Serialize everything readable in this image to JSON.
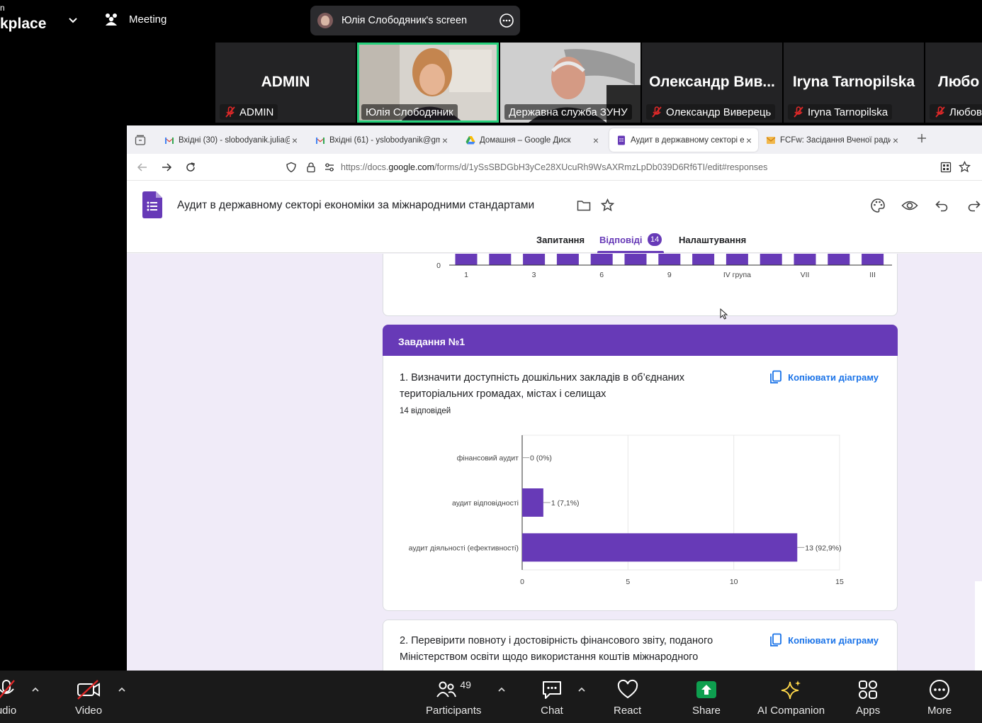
{
  "zoom": {
    "brand_top": "n",
    "brand": "kplace",
    "meeting_label": "Meeting",
    "share_pill_text": "Юлія Слободяник's screen",
    "participants": [
      {
        "big": "ADMIN",
        "name": "ADMIN",
        "muted": true
      },
      {
        "big": "",
        "name": "Юлія Слободяник",
        "muted": false,
        "video": true,
        "active": true
      },
      {
        "big": "",
        "name": "Державна служба ЗУНУ",
        "muted": false,
        "video": true
      },
      {
        "big": "Олександр Вив...",
        "name": "Олександр Виверець",
        "muted": true
      },
      {
        "big": "Iryna Tarnopilska",
        "name": "Iryna Tarnopilska",
        "muted": true
      },
      {
        "big": "Любо",
        "name": "Любов",
        "muted": true
      }
    ],
    "toolbar": {
      "audio": "udio",
      "video": "Video",
      "participants": "Participants",
      "participants_count": "49",
      "chat": "Chat",
      "react": "React",
      "share": "Share",
      "ai": "AI Companion",
      "apps": "Apps",
      "more": "More"
    }
  },
  "browser": {
    "tabs": [
      {
        "title": "Вхідні (30) - slobodyanik.julia@",
        "icon": "gmail-icon"
      },
      {
        "title": "Вхідні (61) - yslobodyanik@gm",
        "icon": "gmail-icon"
      },
      {
        "title": "Домашня – Google Диск",
        "icon": "drive-icon"
      },
      {
        "title": "Аудит в державному секторі е",
        "icon": "forms-icon",
        "active": true
      },
      {
        "title": "FCFw: Засідання Вченої ради е",
        "icon": "mail-icon"
      }
    ],
    "url_prefix": "https://docs.",
    "url_domain": "google.com",
    "url_suffix": "/forms/d/1ySsSBDGbH3yCe28XUcuRh9WsAXRmzLpDb039D6Rf6TI/edit#responses"
  },
  "form": {
    "title": "Аудит в державному секторі економіки за міжнародними стандартами",
    "tabs": {
      "questions": "Запитання",
      "responses": "Відповіді",
      "settings": "Налаштування"
    },
    "responses_count": "14",
    "section_title": "Завдання №1",
    "copy_label": "Копіювати діаграму",
    "q1_title": "1. Визначити доступність дошкільних закладів в об’єднаних територіальних громадах, містах і селищах",
    "q1_count": "14 відповідей",
    "q2_title": "2. Перевірити повноту і достовірність фінансового звіту, поданого Міністерством освіти щодо використання коштів міжнародного"
  },
  "chart_data": [
    {
      "type": "bar",
      "note_visible": "partially scrolled",
      "categories": [
        "1",
        "",
        "3",
        "",
        "6",
        "",
        "9",
        "",
        "IV група",
        "",
        "VII",
        "",
        "III"
      ],
      "tick_labels": [
        "1",
        "3",
        "6",
        "9",
        "IV група",
        "VII",
        "III"
      ],
      "y_tick": "0",
      "bar_count": 13,
      "color": "#673ab7"
    },
    {
      "type": "bar",
      "orientation": "horizontal",
      "categories": [
        "фінансовий аудит",
        "аудит відповідності",
        "аудит діяльності (ефективності)"
      ],
      "values": [
        0,
        1,
        13
      ],
      "data_labels": [
        "0 (0%)",
        "1 (7,1%)",
        "13 (92,9%)"
      ],
      "xlim": [
        0,
        15
      ],
      "x_ticks": [
        "0",
        "5",
        "10",
        "15"
      ],
      "color": "#673ab7",
      "grid": true
    }
  ],
  "colors": {
    "accent": "#673ab7",
    "link": "#1a73e8",
    "active_speaker": "#26d07c",
    "share_green": "#0e9f4f"
  }
}
